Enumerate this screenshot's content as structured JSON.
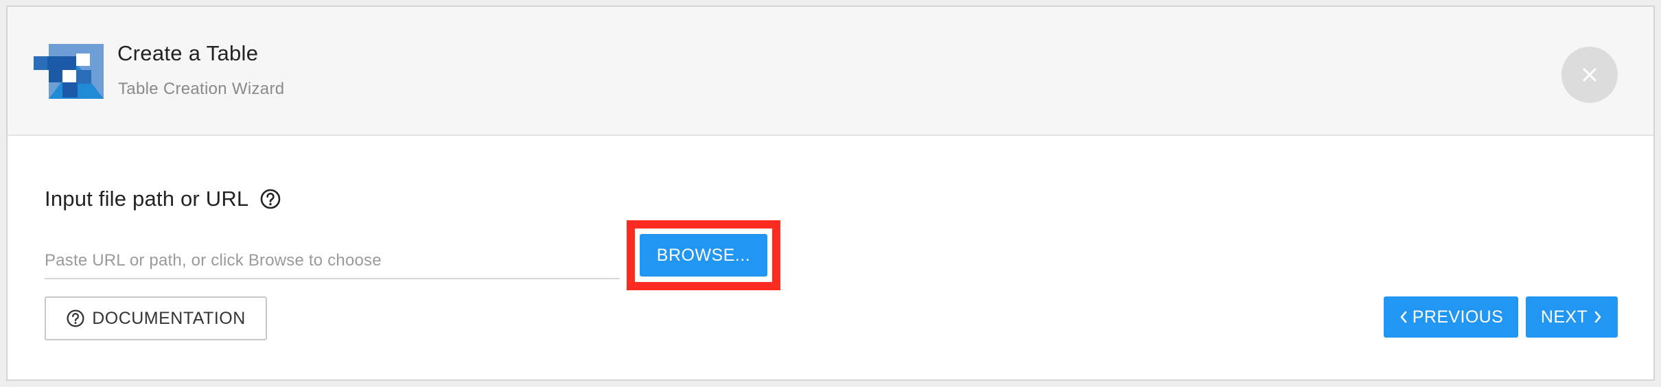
{
  "header": {
    "title": "Create a Table",
    "subtitle": "Table Creation Wizard"
  },
  "icons": {
    "logo": "table-logo-icon",
    "close": "close-icon",
    "help": "help-circle-icon",
    "prev": "chevron-left-icon",
    "next": "chevron-right-icon"
  },
  "form": {
    "label": "Input file path or URL",
    "input_value": "",
    "input_placeholder": "Paste URL or path, or click Browse to choose",
    "browse_label": "BROWSE..."
  },
  "footer": {
    "documentation_label": "DOCUMENTATION",
    "previous_label": "PREVIOUS",
    "next_label": "NEXT"
  },
  "colors": {
    "primary": "#2196f3",
    "highlight": "#ff2a20",
    "header_bg": "#f6f6f6"
  }
}
